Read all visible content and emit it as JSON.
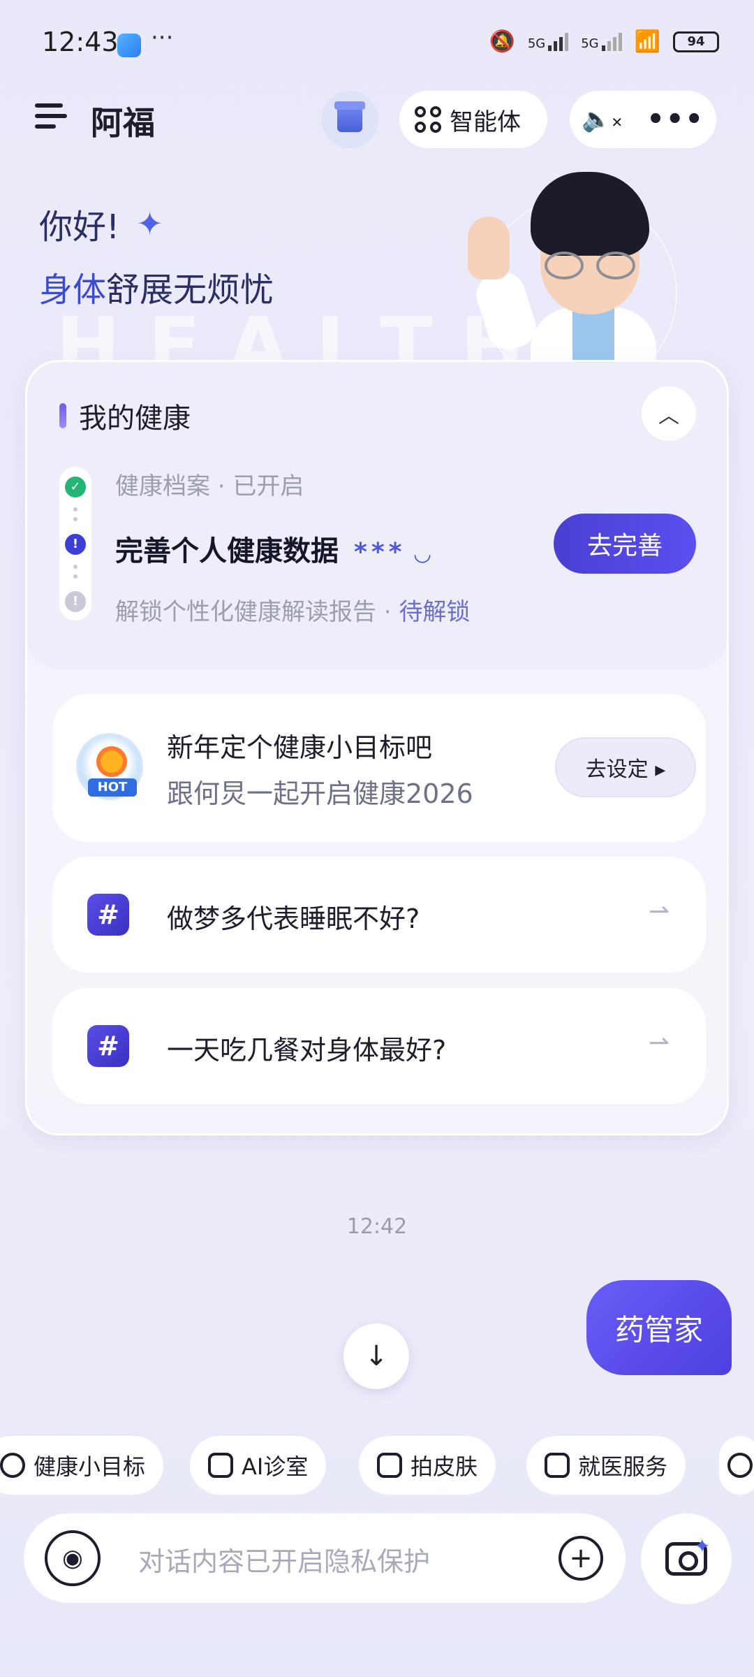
{
  "status_bar": {
    "time": "12:43",
    "more": "···",
    "network1": "5G",
    "network2": "5G",
    "battery": "94"
  },
  "header": {
    "title": "阿福",
    "agent_label": "智能体",
    "mute_icon": "✕",
    "more_icon": "•••"
  },
  "greeting": {
    "hi": "你好!",
    "slogan_highlight": "身体",
    "slogan_rest": "舒展无烦忧",
    "watermark": "HEALTH"
  },
  "health": {
    "title": "我的健康",
    "step1": "健康档案 · 已开启",
    "step2": "完善个人健康数据",
    "step2_mask": "***",
    "step3": "解锁个性化健康解读报告 · ",
    "step3_status": "待解锁",
    "complete_button": "去完善"
  },
  "goal_card": {
    "badge": "HOT",
    "title": "新年定个健康小目标吧",
    "subtitle": "跟何炅一起开启健康2026",
    "button": "去设定 ▸"
  },
  "questions": [
    {
      "text": "做梦多代表睡眠不好?"
    },
    {
      "text": "一天吃几餐对身体最好?"
    }
  ],
  "chat": {
    "time": "12:42",
    "user_message": "药管家"
  },
  "chips": [
    {
      "label": "健康小目标",
      "icon": "target-icon"
    },
    {
      "label": "AI诊室",
      "icon": "chat-plus-icon"
    },
    {
      "label": "拍皮肤",
      "icon": "camera-icon"
    },
    {
      "label": "就医服务",
      "icon": "hospital-icon"
    }
  ],
  "input": {
    "placeholder": "对话内容已开启隐私保护"
  }
}
